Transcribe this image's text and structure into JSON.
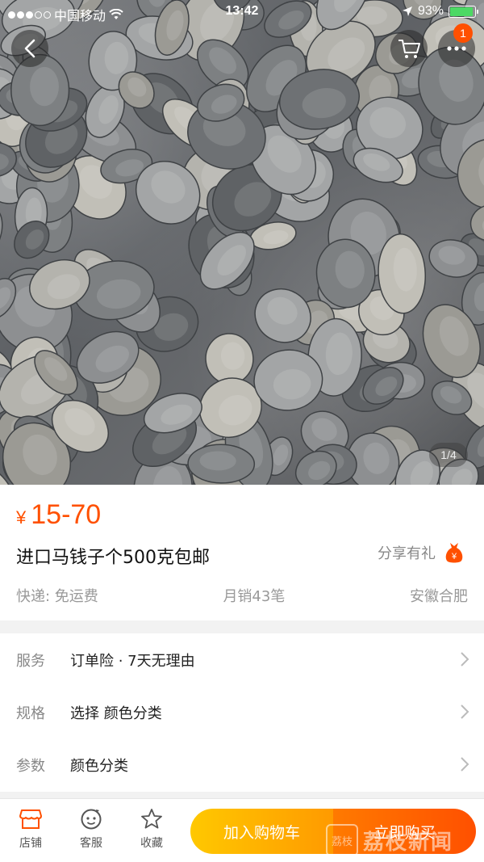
{
  "status_bar": {
    "carrier": "中国移动",
    "time": "13:42",
    "battery": "93%",
    "battery_level": 0.93
  },
  "nav": {
    "cart_badge": "1",
    "pager": "1/4"
  },
  "product": {
    "currency": "¥",
    "price": "15-70",
    "title": "进口马钱子个500克包邮",
    "share_label": "分享有礼",
    "shipping": "快递: 免运费",
    "monthly_sales": "月销43笔",
    "location": "安徽合肥"
  },
  "rows": [
    {
      "label": "服务",
      "value": "订单险 · 7天无理由"
    },
    {
      "label": "规格",
      "value": "选择  颜色分类"
    },
    {
      "label": "参数",
      "value": "颜色分类"
    }
  ],
  "bottom_bar": {
    "shop": "店铺",
    "service": "客服",
    "favorite": "收藏",
    "add_to_cart": "加入购物车",
    "buy_now": "立即购买"
  },
  "watermark": {
    "logo": "荔枝",
    "text": "荔枝新闻"
  },
  "colors": {
    "accent": "#ff5000",
    "cart_gradient": "#ffc800",
    "buy_gradient": "#ff5000"
  }
}
